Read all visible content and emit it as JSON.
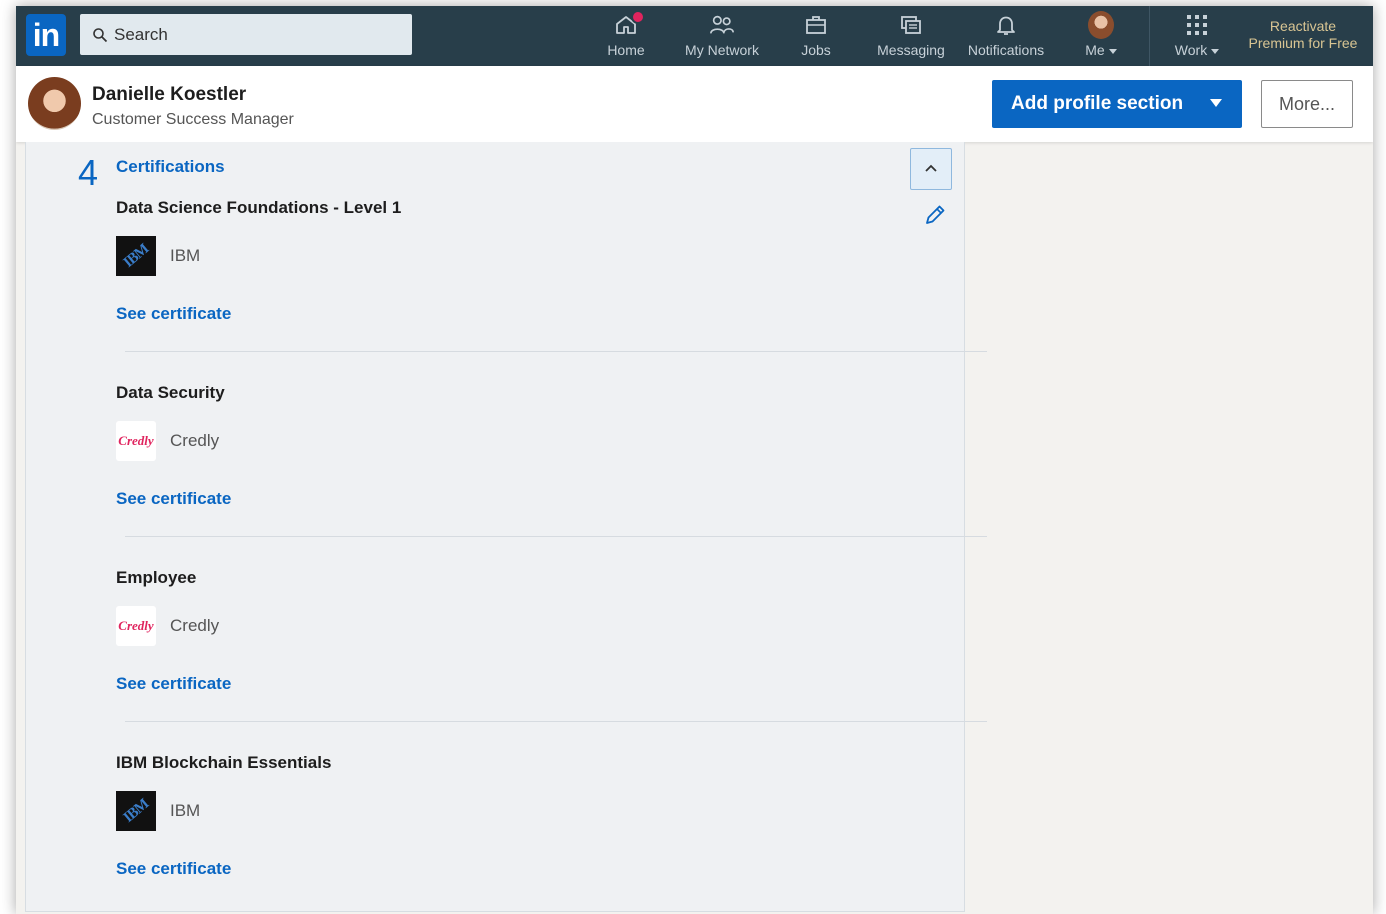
{
  "nav": {
    "logo": "in",
    "search_placeholder": "Search",
    "items": [
      {
        "label": "Home",
        "icon": "home-icon",
        "badge": true
      },
      {
        "label": "My Network",
        "icon": "my-network-icon"
      },
      {
        "label": "Jobs",
        "icon": "jobs-icon"
      },
      {
        "label": "Messaging",
        "icon": "messaging-icon"
      },
      {
        "label": "Notifications",
        "icon": "notifications-icon"
      },
      {
        "label": "Me",
        "icon": "me-avatar"
      },
      {
        "label": "Work",
        "icon": "work-grid-icon"
      }
    ],
    "premium_line1": "Reactivate",
    "premium_line2": "Premium for Free"
  },
  "profile": {
    "name": "Danielle Koestler",
    "title": "Customer Success Manager",
    "add_section_label": "Add profile section",
    "more_label": "More..."
  },
  "section": {
    "step": "4",
    "title": "Certifications",
    "certs": [
      {
        "name": "Data Science Foundations - Level 1",
        "issuer": "IBM",
        "logo": "IBM",
        "link": "See certificate"
      },
      {
        "name": "Data Security",
        "issuer": "Credly",
        "logo": "Credly",
        "link": "See certificate"
      },
      {
        "name": "Employee",
        "issuer": "Credly",
        "logo": "Credly",
        "link": "See certificate"
      },
      {
        "name": "IBM Blockchain Essentials",
        "issuer": "IBM",
        "logo": "IBM",
        "link": "See certificate"
      }
    ]
  },
  "colors": {
    "nav_bg": "#283e4a",
    "brand_blue": "#0a66c2",
    "premium_gold": "#d9c593"
  }
}
